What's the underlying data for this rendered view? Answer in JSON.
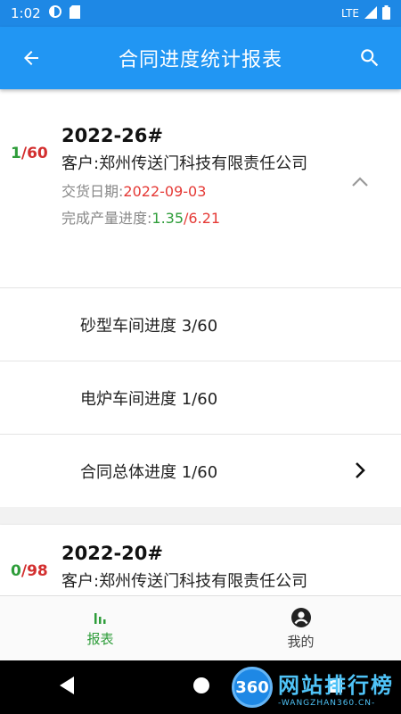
{
  "status_bar": {
    "time": "1:02",
    "network": "LTE"
  },
  "app_bar": {
    "title": "合同进度统计报表"
  },
  "contracts": [
    {
      "done": "1",
      "total": "60",
      "contract_no": "2022-26#",
      "customer_label": "客户:",
      "customer": "郑州传送门科技有限责任公司",
      "delivery_label": "交货日期:",
      "delivery_date": "2022-09-03",
      "progress_label": "完成产量进度:",
      "progress_done": "1.35",
      "progress_total": "6.21",
      "rows": [
        {
          "label": "砂型车间进度 3/60"
        },
        {
          "label": "电炉车间进度 1/60"
        },
        {
          "label": "合同总体进度 1/60"
        }
      ]
    },
    {
      "done": "0",
      "total": "98",
      "contract_no": "2022-20#",
      "customer_label": "客户:",
      "customer": "郑州传送门科技有限责任公司"
    }
  ],
  "bottom_nav": {
    "report_label": "报表",
    "mine_label": "我的"
  },
  "watermark": {
    "number": "360",
    "title": "网站排行榜",
    "url": "-WANGZHAN360.CN-"
  },
  "colors": {
    "primary": "#2196f3",
    "done_green": "#2e9d3a",
    "total_red": "#d32f2f"
  }
}
